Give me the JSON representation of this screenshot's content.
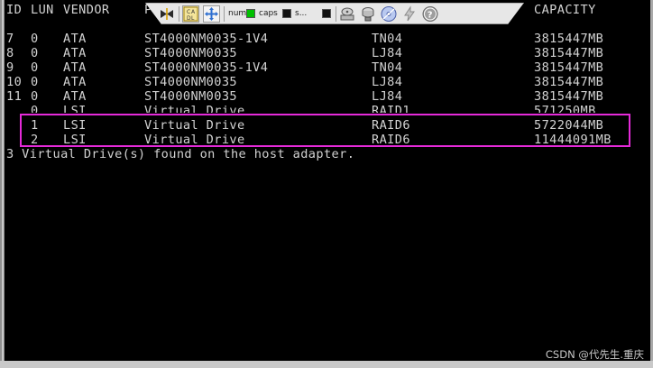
{
  "toolbar": {
    "num_label": "num",
    "caps_label": "caps",
    "scroll_label": "s...",
    "icons": [
      "pin-icon",
      "keyboard-layout-icon",
      "move-icon",
      "num-lock-led",
      "caps-lock-led",
      "scroll-lock-led",
      "disk-icon",
      "network-drive-icon",
      "cd-icon",
      "power-icon",
      "help-icon"
    ],
    "num_led_color": "#00c000",
    "caps_led_color": "#101010",
    "scroll_led_color": "#101010"
  },
  "header": {
    "id": "ID",
    "lun": "LUN",
    "vendor": "VENDOR",
    "product": "P",
    "capacity": "CAPACITY"
  },
  "separator": {
    "id": "-- ",
    "lun": "--- ",
    "vendor": "------",
    "capacity": "--------"
  },
  "rows": [
    {
      "id": "7",
      "lun": "0",
      "vendor": "ATA",
      "product": "ST4000NM0035-1V4",
      "rev": "TN04",
      "capacity": "3815447MB"
    },
    {
      "id": "8",
      "lun": "0",
      "vendor": "ATA",
      "product": "ST4000NM0035",
      "rev": "LJ84",
      "capacity": "3815447MB"
    },
    {
      "id": "9",
      "lun": "0",
      "vendor": "ATA",
      "product": "ST4000NM0035-1V4",
      "rev": "TN04",
      "capacity": "3815447MB"
    },
    {
      "id": "10",
      "lun": "0",
      "vendor": "ATA",
      "product": "ST4000NM0035",
      "rev": "LJ84",
      "capacity": "3815447MB"
    },
    {
      "id": "11",
      "lun": "0",
      "vendor": "ATA",
      "product": "ST4000NM0035",
      "rev": "LJ84",
      "capacity": "3815447MB"
    },
    {
      "id": "",
      "lun": "0",
      "vendor": "LSI",
      "product": "Virtual Drive",
      "rev": "RAID1",
      "capacity": "571250MB"
    },
    {
      "id": "",
      "lun": "1",
      "vendor": "LSI",
      "product": "Virtual Drive",
      "rev": "RAID6",
      "capacity": "5722044MB"
    },
    {
      "id": "",
      "lun": "2",
      "vendor": "LSI",
      "product": "Virtual Drive",
      "rev": "RAID6",
      "capacity": "11444091MB"
    }
  ],
  "footer_message": "3 Virtual Drive(s) found on the host adapter.",
  "highlight_color": "#e52ad9",
  "watermark": "CSDN @代先生.重庆"
}
